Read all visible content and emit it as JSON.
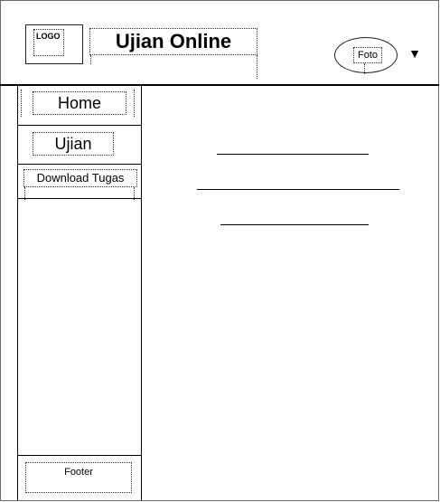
{
  "header": {
    "logo_text": "LOGO",
    "app_title": "Ujian Online",
    "profile_photo_label": "Foto",
    "dropdown_icon": "caret-down-icon",
    "dropdown_glyph": "▼"
  },
  "sidebar": {
    "items": [
      {
        "label": "Home"
      },
      {
        "label": "Ujian"
      },
      {
        "label": "Download Tugas"
      }
    ],
    "footer_label": "Footer"
  },
  "colors": {
    "border": "#000000",
    "background": "#ffffff"
  }
}
